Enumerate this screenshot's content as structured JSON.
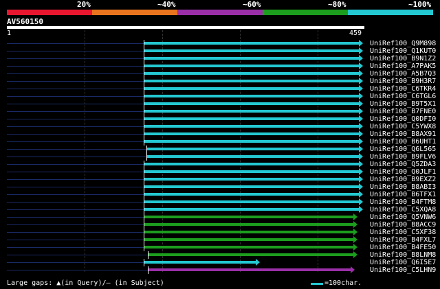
{
  "legend": {
    "labels": [
      "20%",
      "~40%",
      "~60%",
      "~80%",
      "~100%"
    ],
    "colors": [
      "#e8162f",
      "#e8741f",
      "#9a2fa8",
      "#1c9d1e",
      "#23c8d2"
    ]
  },
  "query": {
    "name": "AV560150",
    "start": "1",
    "end": "459"
  },
  "hits": [
    {
      "name": "UniRef100_Q9M898",
      "start": 1,
      "end": 459,
      "color": "#23c8d2"
    },
    {
      "name": "UniRef100_Q1KUT0",
      "start": 1,
      "end": 459,
      "color": "#23c8d2"
    },
    {
      "name": "UniRef100_B9N1Z2",
      "start": 1,
      "end": 459,
      "color": "#23c8d2"
    },
    {
      "name": "UniRef100_A7PAK5",
      "start": 1,
      "end": 459,
      "color": "#23c8d2"
    },
    {
      "name": "UniRef100_A5B7Q3",
      "start": 1,
      "end": 459,
      "color": "#23c8d2"
    },
    {
      "name": "UniRef100_B9H3R7",
      "start": 1,
      "end": 459,
      "color": "#23c8d2"
    },
    {
      "name": "UniRef100_C6TKR4",
      "start": 1,
      "end": 459,
      "color": "#23c8d2"
    },
    {
      "name": "UniRef100_C6TGL6",
      "start": 1,
      "end": 459,
      "color": "#23c8d2"
    },
    {
      "name": "UniRef100_B9T5X1",
      "start": 1,
      "end": 459,
      "color": "#23c8d2"
    },
    {
      "name": "UniRef100_B7FNE0",
      "start": 1,
      "end": 459,
      "color": "#23c8d2"
    },
    {
      "name": "UniRef100_Q0DFI0",
      "start": 1,
      "end": 459,
      "color": "#23c8d2"
    },
    {
      "name": "UniRef100_C5YWX8",
      "start": 1,
      "end": 459,
      "color": "#23c8d2"
    },
    {
      "name": "UniRef100_B8AX91",
      "start": 1,
      "end": 459,
      "color": "#23c8d2"
    },
    {
      "name": "UniRef100_B6UHT1",
      "start": 1,
      "end": 459,
      "color": "#23c8d2"
    },
    {
      "name": "UniRef100_Q6L565",
      "start": 4,
      "end": 459,
      "color": "#23c8d2"
    },
    {
      "name": "UniRef100_B9FLV6",
      "start": 4,
      "end": 459,
      "color": "#23c8d2"
    },
    {
      "name": "UniRef100_Q5ZDA3",
      "start": 1,
      "end": 459,
      "color": "#23c8d2"
    },
    {
      "name": "UniRef100_Q0JLF1",
      "start": 1,
      "end": 459,
      "color": "#23c8d2"
    },
    {
      "name": "UniRef100_B9EXZ2",
      "start": 1,
      "end": 459,
      "color": "#23c8d2"
    },
    {
      "name": "UniRef100_B8ABI3",
      "start": 1,
      "end": 459,
      "color": "#23c8d2"
    },
    {
      "name": "UniRef100_B6TFX1",
      "start": 1,
      "end": 459,
      "color": "#23c8d2"
    },
    {
      "name": "UniRef100_B4FTM8",
      "start": 1,
      "end": 459,
      "color": "#23c8d2"
    },
    {
      "name": "UniRef100_C5XQA8",
      "start": 1,
      "end": 459,
      "color": "#23c8d2"
    },
    {
      "name": "UniRef100_Q5VNW6",
      "start": 1,
      "end": 452,
      "color": "#1c9d1e"
    },
    {
      "name": "UniRef100_B8ACC9",
      "start": 1,
      "end": 452,
      "color": "#1c9d1e"
    },
    {
      "name": "UniRef100_C5XF38",
      "start": 1,
      "end": 452,
      "color": "#1c9d1e"
    },
    {
      "name": "UniRef100_B4FXL7",
      "start": 1,
      "end": 452,
      "color": "#1c9d1e"
    },
    {
      "name": "UniRef100_B4FE50",
      "start": 1,
      "end": 452,
      "color": "#1c9d1e"
    },
    {
      "name": "UniRef100_B8LNM8",
      "start": 6,
      "end": 452,
      "color": "#1c9d1e"
    },
    {
      "name": "UniRef100_Q6I5E7",
      "start": 1,
      "end": 327,
      "color": "#23c8d2"
    },
    {
      "name": "UniRef100_C5LHN9",
      "start": 6,
      "end": 448,
      "color": "#9a2fa8"
    }
  ],
  "footer": {
    "gaps_text": "Large gaps: ▲(in Query)/– (in Subject)",
    "scale_text": "=100char."
  }
}
